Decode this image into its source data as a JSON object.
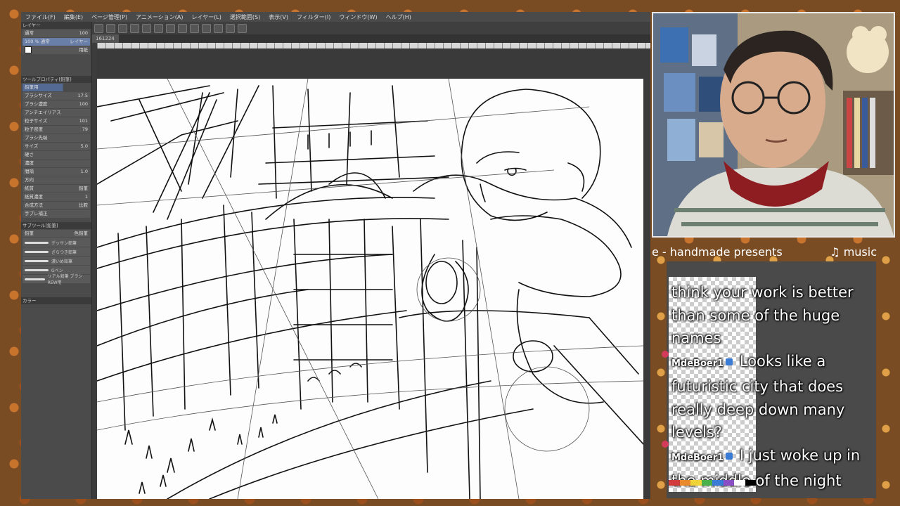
{
  "app": {
    "menu": [
      "ファイル(F)",
      "編集(E)",
      "ページ管理(P)",
      "アニメーション(A)",
      "レイヤー(L)",
      "選択範囲(S)",
      "表示(V)",
      "フィルター(I)",
      "ウィンドウ(W)",
      "ヘルプ(H)"
    ],
    "doc_tab": "161224",
    "layer_panel": {
      "header": "レイヤー",
      "blend_mode": "通常",
      "opacity": "100",
      "layers": [
        {
          "name": "100 % 通常",
          "sub": "レイヤー",
          "selected": true
        },
        {
          "name": "用紙",
          "sub": "",
          "selected": false
        }
      ]
    },
    "tool_property": {
      "header": "ツールプロパティ[鉛筆]",
      "tool": "鉛筆用",
      "rows": [
        {
          "label": "ブラシサイズ",
          "value": "17.5"
        },
        {
          "label": "ブラシ濃度",
          "value": "100"
        },
        {
          "label": "アンチエイリアス",
          "value": ""
        },
        {
          "label": "粒子サイズ",
          "value": "101"
        },
        {
          "label": "粒子密度",
          "value": "79"
        },
        {
          "label": "ブラシ先端",
          "value": ""
        },
        {
          "label": "サイズ",
          "value": "5.0"
        },
        {
          "label": "硬さ",
          "value": ""
        },
        {
          "label": "濃度",
          "value": ""
        },
        {
          "label": "間隔",
          "value": "1.0"
        },
        {
          "label": "方向",
          "value": ""
        },
        {
          "label": "紙質",
          "value": "鉛筆"
        },
        {
          "label": "紙質濃度",
          "value": "1"
        },
        {
          "label": "合成方法",
          "value": "比較"
        },
        {
          "label": "手ブレ補正",
          "value": ""
        }
      ]
    },
    "sub_tool": {
      "header": "サブツール[鉛筆]",
      "tabs": [
        "鉛筆",
        "色鉛筆"
      ],
      "brushes": [
        "デッサン鉛筆",
        "ざらつき鉛筆",
        "濃いめ鉛筆",
        "Gペン",
        "リアル鉛筆 ブラシ REW用"
      ]
    },
    "color_panel": {
      "label": "カラー"
    }
  },
  "stream": {
    "ticker_left": "e - handmade presents",
    "ticker_right": "♫ music",
    "chat": [
      {
        "user": "",
        "text": "think your work is better than some of the huge names"
      },
      {
        "user": "MdeBoer1",
        "text": "Looks like a futuristic city that does really deep down many levels?"
      },
      {
        "user": "MdeBoer1",
        "text": "I just woke up in the middle of the night"
      }
    ]
  },
  "colors": {
    "accent": "#6a7fa8",
    "badge": "#3a7bd5",
    "alert": "#d23b5a"
  },
  "palette": [
    "#d23b3b",
    "#e8892d",
    "#f0d23b",
    "#4ab04a",
    "#3a7bd5",
    "#8a4fc4",
    "#ffffff",
    "#000000"
  ]
}
